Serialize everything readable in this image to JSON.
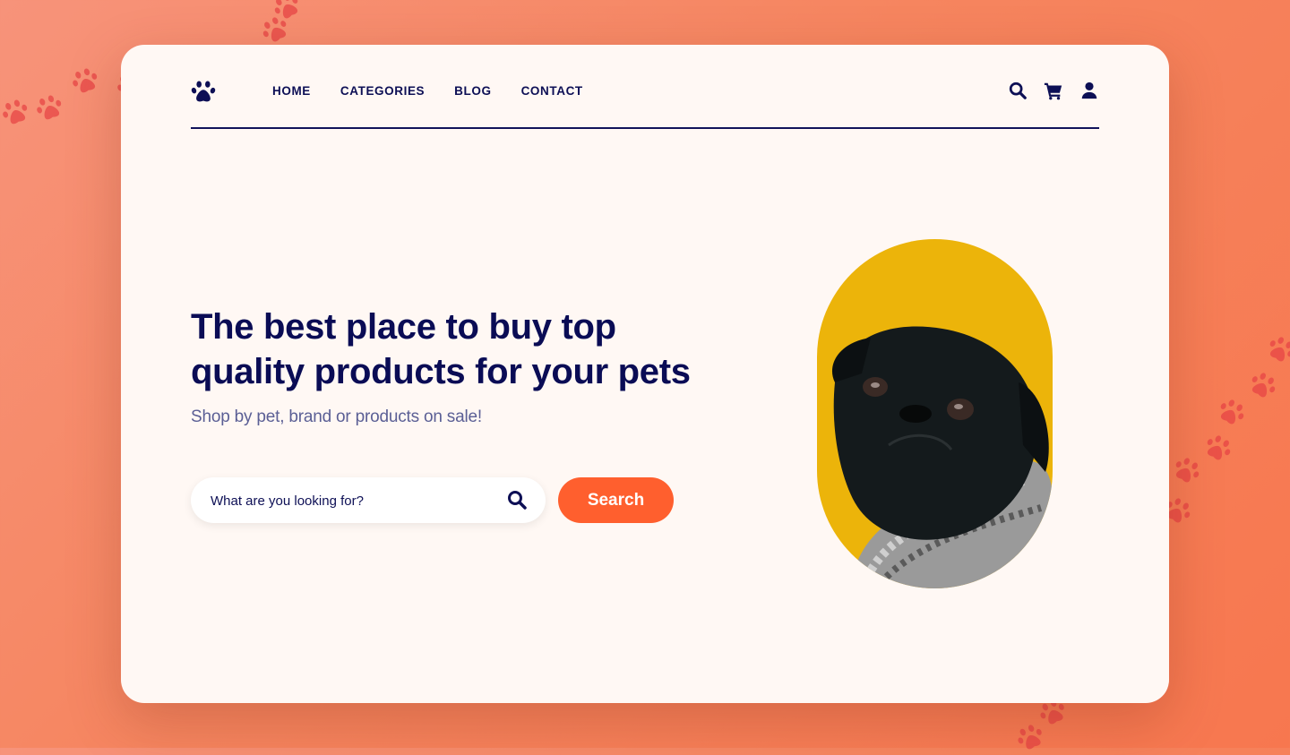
{
  "brand": {
    "logo_icon": "paw-icon"
  },
  "nav": {
    "links": [
      {
        "label": "HOME"
      },
      {
        "label": "CATEGORIES"
      },
      {
        "label": "BLOG"
      },
      {
        "label": "CONTACT"
      }
    ],
    "icons": [
      "search-icon",
      "cart-icon",
      "user-icon"
    ]
  },
  "hero": {
    "title": "The best place to buy top quality products for your pets",
    "subtitle": "Shop by pet, brand or products on sale!",
    "search": {
      "placeholder": "What are you looking for?",
      "value": "",
      "button_label": "Search"
    },
    "image": {
      "alt": "Black pug wearing a knitted scarf on yellow background"
    }
  },
  "colors": {
    "accent": "#ff5f2e",
    "navy": "#0d0f55",
    "card_bg": "#fff8f4",
    "image_bg": "#ecb40a",
    "background": "#f6855f",
    "paw_prints": "#e84545"
  }
}
